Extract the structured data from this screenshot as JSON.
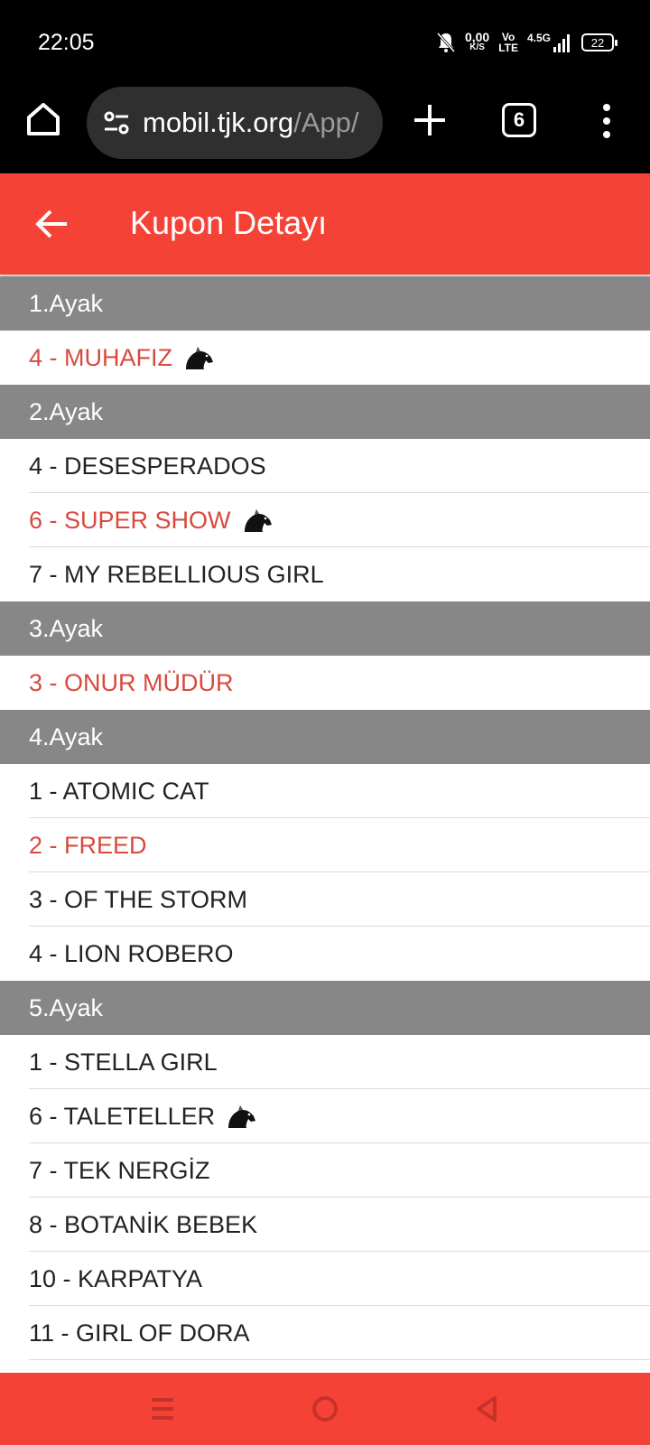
{
  "status_bar": {
    "time": "22:05",
    "net_speed_value": "0,00",
    "net_speed_unit": "K/S",
    "volte_top": "Vo",
    "volte_bottom": "LTE",
    "network": "4.5G",
    "battery": "22",
    "icons": [
      "bell-off-icon",
      "signal-icon",
      "battery-icon"
    ]
  },
  "browser": {
    "url_host": "mobil.tjk.org",
    "url_path": "/App/",
    "tab_count": "6",
    "icons": [
      "home-icon",
      "site-settings-icon",
      "plus-icon",
      "tabs-icon",
      "menu-dots-icon"
    ]
  },
  "header": {
    "title": "Kupon Detayı",
    "back_icon": "arrow-back-icon"
  },
  "legs": [
    {
      "title": "1.Ayak",
      "horses": [
        {
          "label": "4 - MUHAFIZ",
          "highlight": true,
          "icon": true
        }
      ]
    },
    {
      "title": "2.Ayak",
      "horses": [
        {
          "label": "4 - DESESPERADOS",
          "highlight": false,
          "icon": false
        },
        {
          "label": "6 - SUPER SHOW",
          "highlight": true,
          "icon": true
        },
        {
          "label": "7 - MY REBELLIOUS GIRL",
          "highlight": false,
          "icon": false
        }
      ]
    },
    {
      "title": "3.Ayak",
      "horses": [
        {
          "label": "3 - ONUR MÜDÜR",
          "highlight": true,
          "icon": false
        }
      ]
    },
    {
      "title": "4.Ayak",
      "horses": [
        {
          "label": "1 - ATOMIC CAT",
          "highlight": false,
          "icon": false
        },
        {
          "label": "2 - FREED",
          "highlight": true,
          "icon": false
        },
        {
          "label": "3 - OF THE STORM",
          "highlight": false,
          "icon": false
        },
        {
          "label": "4 - LION ROBERO",
          "highlight": false,
          "icon": false
        }
      ]
    },
    {
      "title": "5.Ayak",
      "horses": [
        {
          "label": "1 - STELLA GIRL",
          "highlight": false,
          "icon": false
        },
        {
          "label": "6 - TALETELLER",
          "highlight": false,
          "icon": true
        },
        {
          "label": "7 - TEK NERGİZ",
          "highlight": false,
          "icon": false
        },
        {
          "label": "8 - BOTANİK BEBEK",
          "highlight": false,
          "icon": false
        },
        {
          "label": "10 - KARPATYA",
          "highlight": false,
          "icon": false
        },
        {
          "label": "11 - GIRL OF DORA",
          "highlight": false,
          "icon": false
        }
      ]
    }
  ],
  "colors": {
    "accent": "#f44336",
    "highlight_text": "#d84a3d",
    "section_bg": "#878787"
  },
  "nav": {
    "icons": [
      "recents-icon",
      "home-circle-icon",
      "back-triangle-icon"
    ]
  }
}
